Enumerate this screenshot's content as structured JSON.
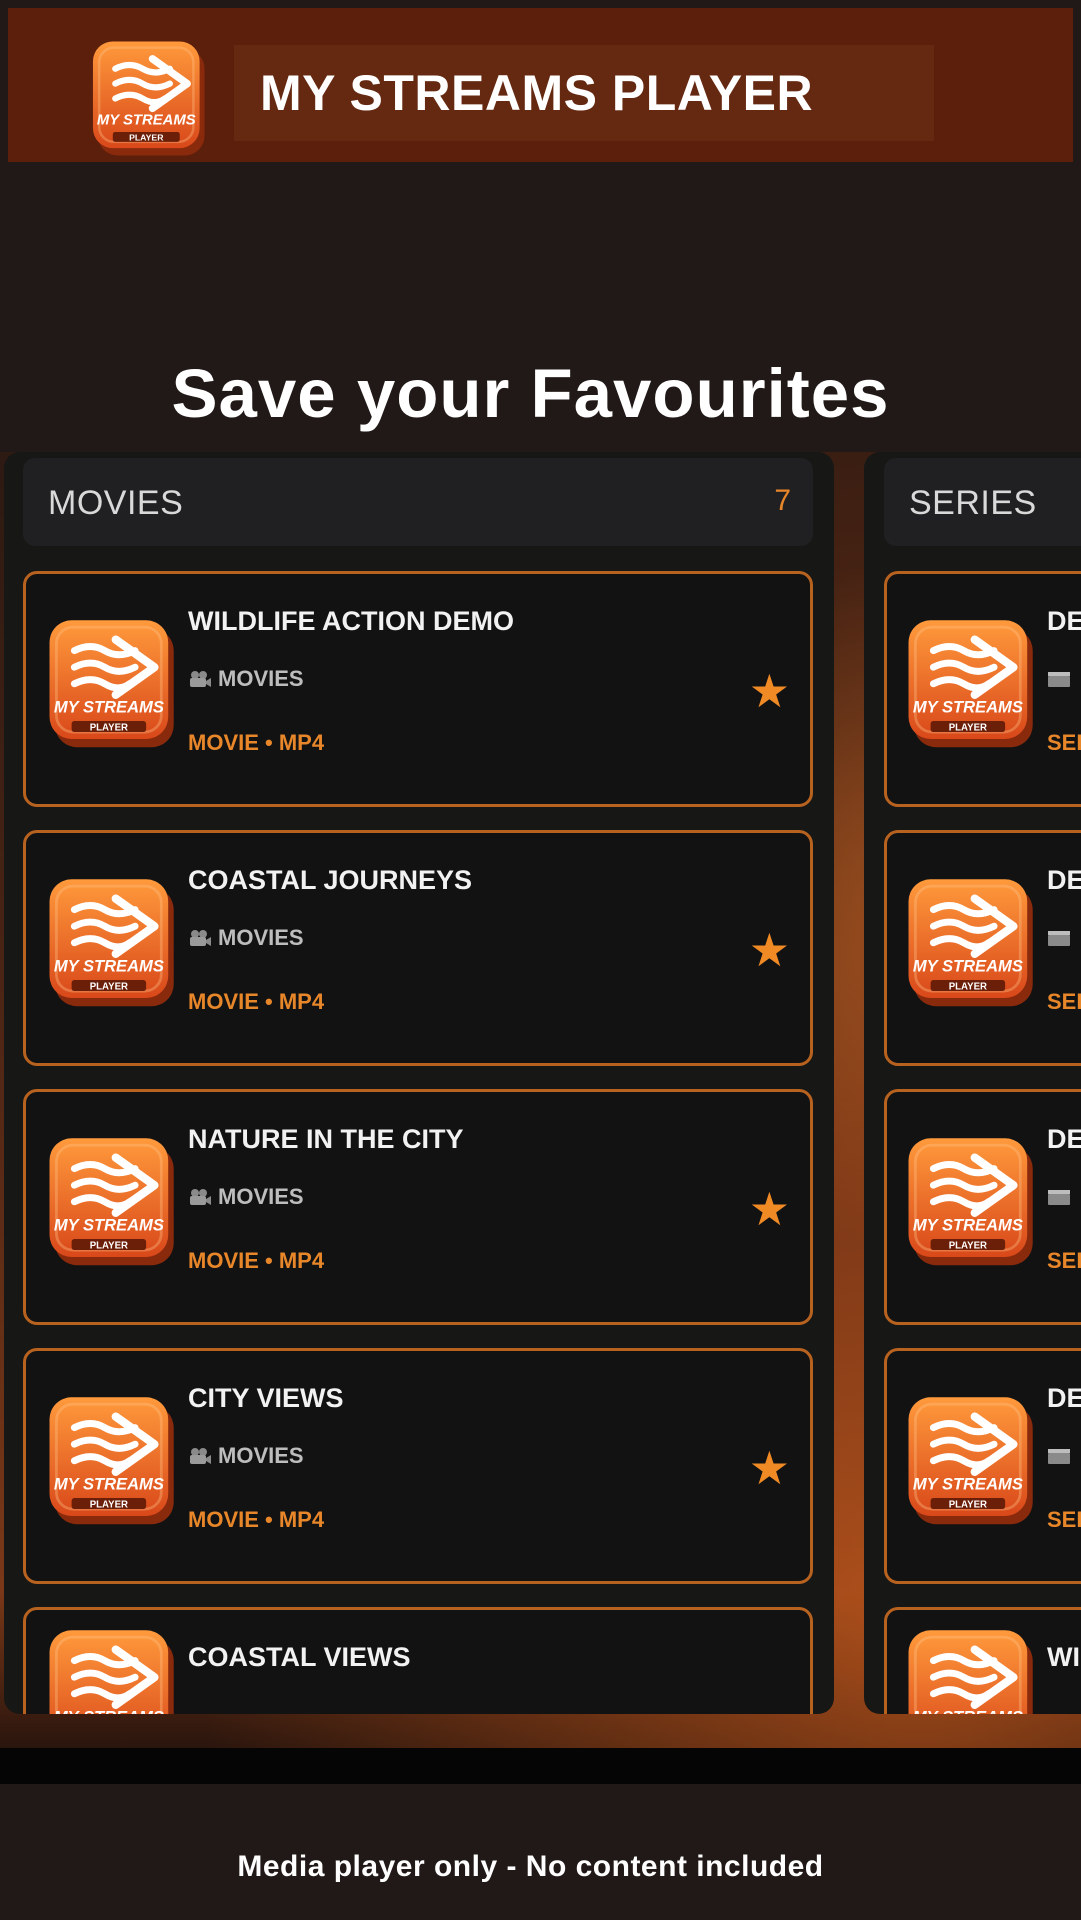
{
  "header": {
    "title": "MY STREAMS PLAYER"
  },
  "headline": "Save your Favourites",
  "logo": {
    "line1": "MY STREAMS",
    "line2": "PLAYER"
  },
  "movies_panel": {
    "title": "MOVIES",
    "count": "7",
    "items": [
      {
        "title": "WILDLIFE ACTION DEMO",
        "category": "MOVIES",
        "meta": "MOVIE • MP4",
        "icon": "star-icon"
      },
      {
        "title": "COASTAL JOURNEYS",
        "category": "MOVIES",
        "meta": "MOVIE • MP4",
        "icon": "star-icon"
      },
      {
        "title": "NATURE IN THE CITY",
        "category": "MOVIES",
        "meta": "MOVIE • MP4",
        "icon": "star-icon"
      },
      {
        "title": "CITY VIEWS",
        "category": "MOVIES",
        "meta": "MOVIE • MP4",
        "icon": "star-icon"
      },
      {
        "title": "COASTAL VIEWS",
        "category": "",
        "meta": "",
        "icon": "star-icon"
      }
    ]
  },
  "series_panel": {
    "title": "SERIES",
    "items": [
      {
        "title": "DE",
        "meta": "SER"
      },
      {
        "title": "DE",
        "meta": "SER"
      },
      {
        "title": "DE",
        "meta": "SER"
      },
      {
        "title": "DE",
        "meta": "SER"
      },
      {
        "title": "WI",
        "meta": ""
      }
    ]
  },
  "footer": {
    "disclaimer": "Media player only - No content included"
  },
  "colors": {
    "accent": "#e8862a",
    "topbar": "#5c1f0c",
    "card_border": "#b8621f",
    "background": "#211917"
  }
}
